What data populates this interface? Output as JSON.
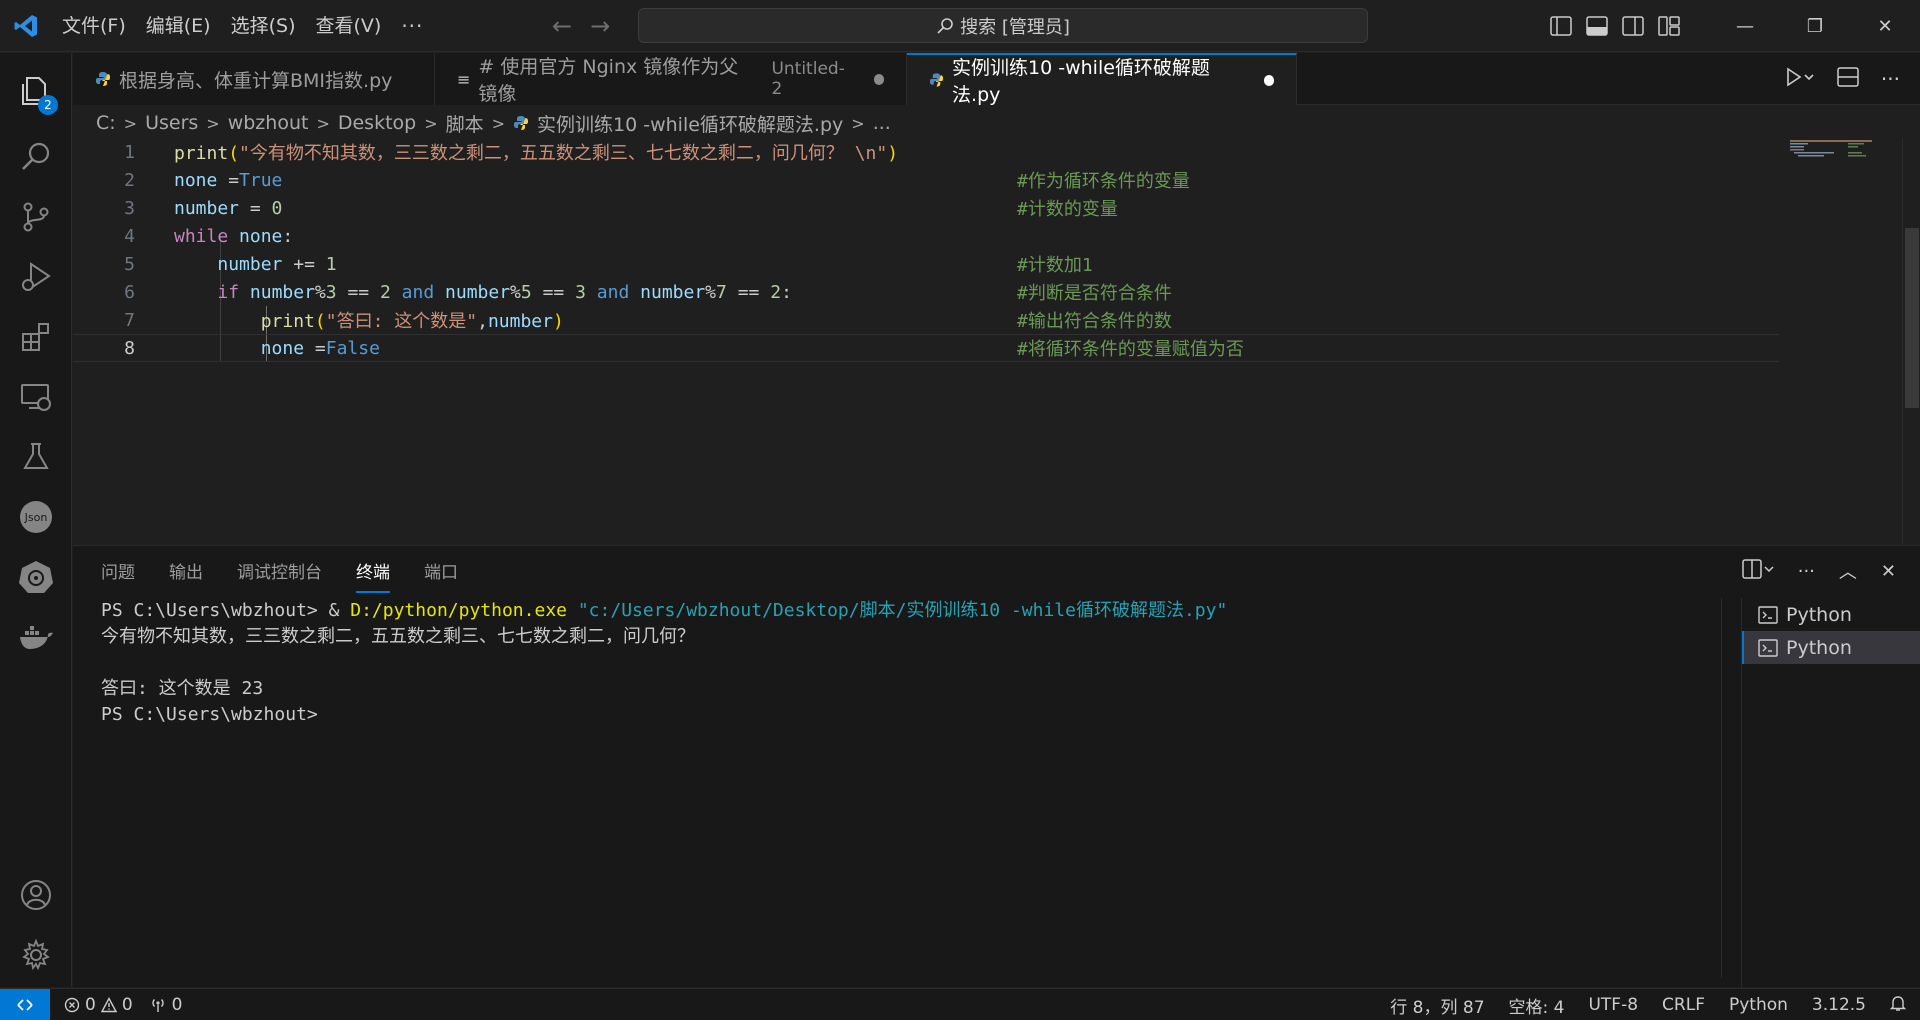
{
  "menu": {
    "items": [
      "文件(F)",
      "编辑(E)",
      "选择(S)",
      "查看(V)"
    ],
    "more": "···"
  },
  "search": {
    "label": "搜索 [管理员]"
  },
  "activity": {
    "badge": "2"
  },
  "tabs": [
    {
      "label": "根据身高、体重计算BMI指数.py"
    },
    {
      "label": "# 使用官方 Nginx 镜像作为父镜像",
      "sub": "Untitled-2"
    },
    {
      "label": "实例训练10 -while循环破解题法.py"
    }
  ],
  "breadcrumb": [
    "C:",
    "Users",
    "wbzhout",
    "Desktop",
    "脚本",
    "实例训练10 -while循环破解题法.py",
    "..."
  ],
  "editor": {
    "lines": [
      {
        "n": "1",
        "c": "#作为循环条件的变量"
      },
      {
        "n": "2",
        "c": "#作为循环条件的变量"
      },
      {
        "n": "3",
        "c": "#计数的变量"
      },
      {
        "n": "4",
        "c": ""
      },
      {
        "n": "5",
        "c": "#计数加1"
      },
      {
        "n": "6",
        "c": "#判断是否符合条件"
      },
      {
        "n": "7",
        "c": "#输出符合条件的数"
      },
      {
        "n": "8",
        "c": "#将循环条件的变量赋值为否"
      }
    ],
    "l1_str": "\"今有物不知其数，三三数之剩二，五五数之剩三、七七数之剩二，问几何？ \\n\"",
    "l7_str": "\"答曰: 这个数是\""
  },
  "panel": {
    "tabs": [
      "问题",
      "输出",
      "调试控制台",
      "终端",
      "端口"
    ],
    "terminal": {
      "cmd_prompt": "PS C:\\Users\\wbzhout> & ",
      "cmd_exe": "D:/python/python.exe",
      "cmd_arg": "\"c:/Users/wbzhout/Desktop/脚本/实例训练10 -while循环破解题法.py\"",
      "out1": "今有物不知其数，三三数之剩二，五五数之剩三、七七数之剩二，问几何？",
      "out2": "答曰: 这个数是 23",
      "prompt": "PS C:\\Users\\wbzhout>"
    },
    "terminals": [
      "Python",
      "Python"
    ]
  },
  "status": {
    "errors": "0",
    "warnings": "0",
    "ports": "0",
    "position": "行 8，列 87",
    "spaces": "空格: 4",
    "encoding": "UTF-8",
    "eol": "CRLF",
    "language": "Python",
    "version": "3.12.5"
  }
}
